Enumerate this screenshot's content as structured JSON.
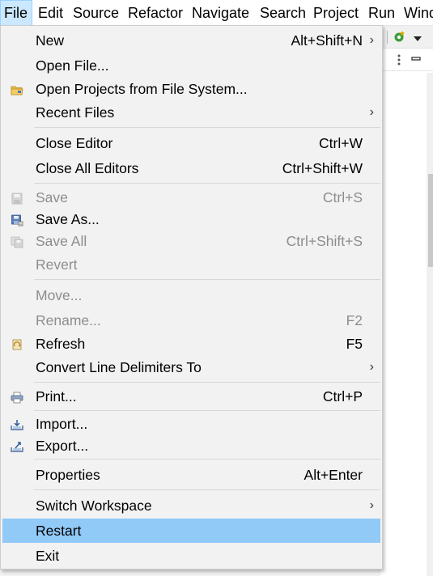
{
  "menubar": {
    "items": [
      "File",
      "Edit",
      "Source",
      "Refactor",
      "Navigate",
      "Search",
      "Project",
      "Run",
      "Wind"
    ]
  },
  "file_menu": {
    "items": [
      {
        "label": "New",
        "shortcut": "Alt+Shift+N",
        "submenu": true,
        "enabled": true
      },
      {
        "label": "Open File...",
        "shortcut": "",
        "enabled": true
      },
      {
        "label": "Open Projects from File System...",
        "shortcut": "",
        "icon": "folder-icon",
        "enabled": true
      },
      {
        "label": "Recent Files",
        "shortcut": "",
        "submenu": true,
        "enabled": true
      },
      {
        "label": "Close Editor",
        "shortcut": "Ctrl+W",
        "enabled": true
      },
      {
        "label": "Close All Editors",
        "shortcut": "Ctrl+Shift+W",
        "enabled": true
      },
      {
        "label": "Save",
        "shortcut": "Ctrl+S",
        "icon": "save-icon",
        "enabled": false
      },
      {
        "label": "Save As...",
        "shortcut": "",
        "icon": "save-as-icon",
        "enabled": true
      },
      {
        "label": "Save All",
        "shortcut": "Ctrl+Shift+S",
        "icon": "save-all-icon",
        "enabled": false
      },
      {
        "label": "Revert",
        "shortcut": "",
        "enabled": false
      },
      {
        "label": "Move...",
        "shortcut": "",
        "enabled": false
      },
      {
        "label": "Rename...",
        "shortcut": "F2",
        "enabled": false
      },
      {
        "label": "Refresh",
        "shortcut": "F5",
        "icon": "refresh-icon",
        "enabled": true
      },
      {
        "label": "Convert Line Delimiters To",
        "shortcut": "",
        "submenu": true,
        "enabled": true
      },
      {
        "label": "Print...",
        "shortcut": "Ctrl+P",
        "icon": "printer-icon",
        "enabled": true
      },
      {
        "label": "Import...",
        "shortcut": "",
        "icon": "import-icon",
        "enabled": true
      },
      {
        "label": "Export...",
        "shortcut": "",
        "icon": "export-icon",
        "enabled": true
      },
      {
        "label": "Properties",
        "shortcut": "Alt+Enter",
        "enabled": true
      },
      {
        "label": "Switch Workspace",
        "shortcut": "",
        "submenu": true,
        "enabled": true
      },
      {
        "label": "Restart",
        "shortcut": "",
        "highlighted": true,
        "enabled": true
      },
      {
        "label": "Exit",
        "shortcut": "",
        "enabled": true
      }
    ],
    "submenu_arrow": "›"
  },
  "colors": {
    "highlight": "#91c9f7",
    "disabled_text": "#8d8d8d",
    "menu_bg": "#f2f2f2",
    "active_menubar_bg": "#cce8ff"
  }
}
